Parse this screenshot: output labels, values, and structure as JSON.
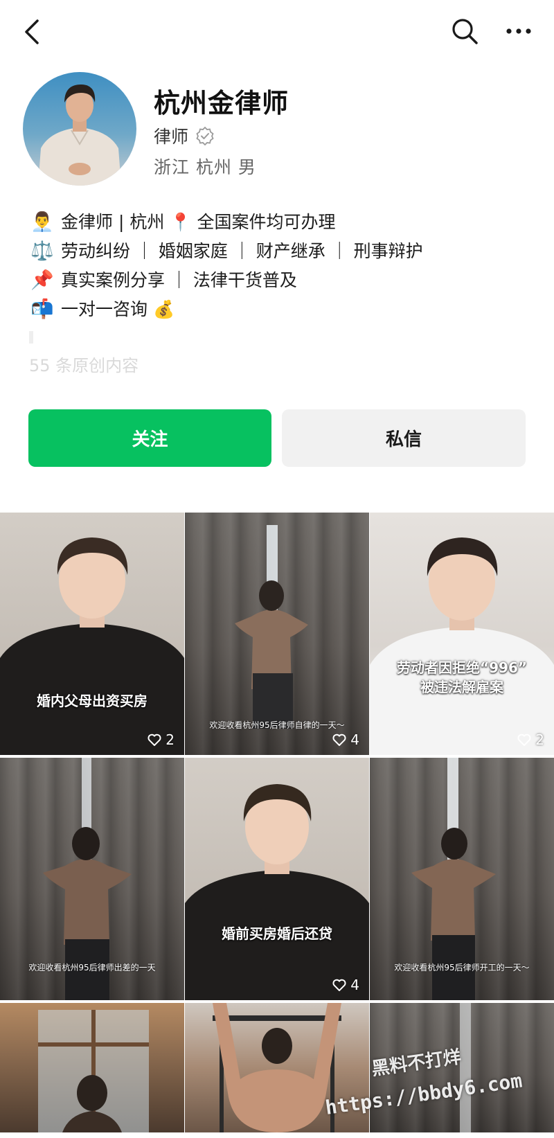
{
  "profile": {
    "name": "杭州金律师",
    "role": "律师",
    "location": "浙江 杭州 男",
    "original_count": "55 条原创内容"
  },
  "bio": {
    "line1": {
      "emoji": "👨‍💼",
      "text1": "金律师 | 杭州",
      "emoji2": "📍",
      "text2": "全国案件均可办理"
    },
    "line2": {
      "emoji": "⚖️",
      "text": "劳动纠纷 ｜ 婚姻家庭 ｜ 财产继承 ｜ 刑事辩护"
    },
    "line3": {
      "emoji": "📌",
      "text": "真实案例分享 ｜ 法律干货普及"
    },
    "line4": {
      "emoji": "📬",
      "text": "一对一咨询",
      "emoji2": "💰"
    }
  },
  "buttons": {
    "follow": "关注",
    "message": "私信"
  },
  "posts": [
    {
      "caption": "婚内父母出资买房",
      "likes": "2"
    },
    {
      "caption": "欢迎收看杭州95后律师自律的一天～",
      "likes": "4"
    },
    {
      "caption": "劳动者因拒绝“996”\n被违法解雇案",
      "likes": "2"
    },
    {
      "caption": "欢迎收看杭州95后律师出差的一天",
      "likes": ""
    },
    {
      "caption": "婚前买房婚后还贷",
      "likes": "4"
    },
    {
      "caption": "欢迎收看杭州95后律师开工的一天～",
      "likes": ""
    },
    {
      "caption": "",
      "likes": ""
    },
    {
      "caption": "",
      "likes": ""
    },
    {
      "caption": "",
      "likes": ""
    }
  ],
  "watermark": {
    "line1": "黑料不打烊",
    "line2": "https://bbdy6.com"
  },
  "icons": {
    "back": "chevron-left-icon",
    "search": "search-icon",
    "more": "more-icon",
    "verified": "verified-badge-icon",
    "heart": "heart-icon"
  },
  "colors": {
    "follow_bg": "#07c160",
    "message_bg": "#f1f1f1"
  }
}
